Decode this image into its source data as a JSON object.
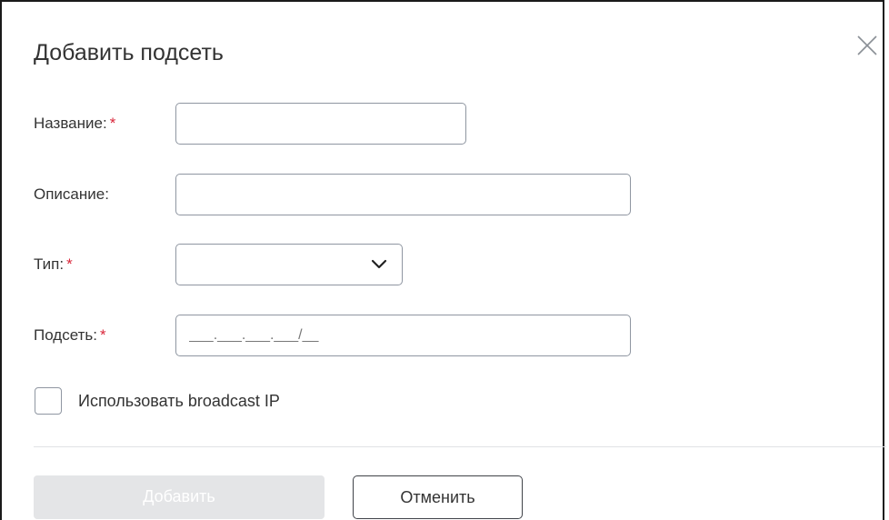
{
  "dialog": {
    "title": "Добавить подсеть",
    "close_icon": "close-icon"
  },
  "form": {
    "name": {
      "label": "Название:",
      "required_mark": "*",
      "value": "",
      "placeholder": ""
    },
    "description": {
      "label": "Описание:",
      "value": "",
      "placeholder": ""
    },
    "type": {
      "label": "Тип:",
      "required_mark": "*",
      "selected": "",
      "icon": "chevron-down-icon"
    },
    "subnet": {
      "label": "Подсеть:",
      "required_mark": "*",
      "value": "",
      "placeholder": "___.___.___.___/__"
    },
    "broadcast": {
      "label": "Использовать broadcast IP",
      "checked": false
    }
  },
  "footer": {
    "add_label": "Добавить",
    "cancel_label": "Отменить"
  },
  "colors": {
    "required": "#d9263a",
    "border": "#8f96a1",
    "disabled_button": "#e4e5e7"
  }
}
